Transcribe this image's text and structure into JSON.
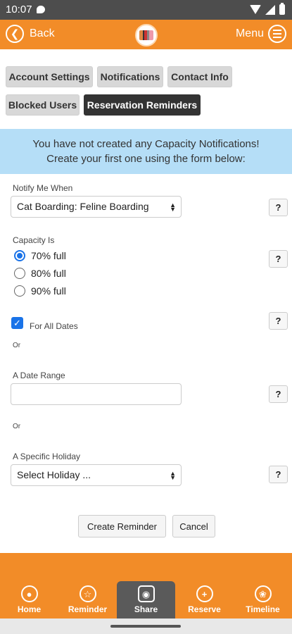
{
  "status_bar": {
    "time": "10:07"
  },
  "header": {
    "back_label": "Back",
    "menu_label": "Menu"
  },
  "tabs": [
    {
      "label": "Account Settings",
      "active": false
    },
    {
      "label": "Notifications",
      "active": false
    },
    {
      "label": "Contact Info",
      "active": false
    },
    {
      "label": "Blocked Users",
      "active": false
    },
    {
      "label": "Reservation Reminders",
      "active": true
    }
  ],
  "banner": {
    "line1": "You have not created any Capacity Notifications!",
    "line2": "Create your first one using the form below:"
  },
  "form": {
    "notify_label": "Notify Me When",
    "notify_value": "Cat Boarding: Feline Boarding",
    "capacity_label": "Capacity Is",
    "capacity_options": [
      "70% full",
      "80% full",
      "90% full"
    ],
    "capacity_selected": "70% full",
    "all_dates_label": "For All Dates",
    "all_dates_checked": true,
    "or_text": "Or",
    "date_range_label": "A Date Range",
    "date_range_value": "",
    "holiday_label": "A Specific Holiday",
    "holiday_value": "Select Holiday ...",
    "help_label": "?"
  },
  "actions": {
    "create_label": "Create Reminder",
    "cancel_label": "Cancel"
  },
  "bottom_nav": [
    {
      "label": "Home",
      "icon": "person-icon"
    },
    {
      "label": "Reminder",
      "icon": "star-icon"
    },
    {
      "label": "Share",
      "icon": "camera-icon",
      "active": true
    },
    {
      "label": "Reserve",
      "icon": "plus-icon"
    },
    {
      "label": "Timeline",
      "icon": "paw-icon"
    }
  ],
  "colors": {
    "accent": "#f28c28",
    "banner": "#b5def7",
    "active_tab": "#333333",
    "selection": "#1a73e8"
  }
}
